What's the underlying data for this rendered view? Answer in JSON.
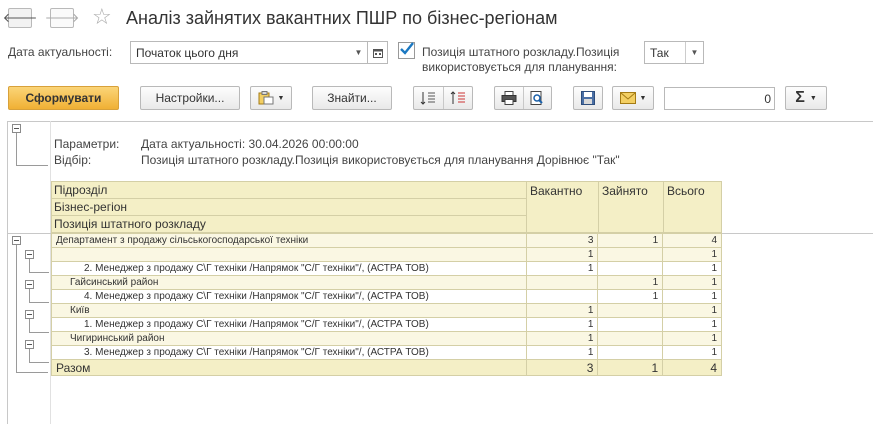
{
  "header": {
    "title": "Аналіз зайнятих вакантних ПШР по бізнес-регіонам",
    "back_glyph": "🡐",
    "forward_glyph": "🡒",
    "star_glyph": "☆"
  },
  "filters": {
    "date_label": "Дата актуальності:",
    "date_value": "Початок цього дня",
    "position_label_line1": "Позиція штатного розкладу.Позиція",
    "position_label_line2": "використовується для планування:",
    "position_checked": true,
    "position_value": "Так"
  },
  "toolbar": {
    "generate": "Сформувати",
    "settings": "Настройки...",
    "find": "Знайти...",
    "sum_value": "0",
    "sigma": "Σ"
  },
  "report": {
    "params_label": "Параметри:",
    "params_value": "Дата актуальності: 30.04.2026 00:00:00",
    "filter_label": "Відбір:",
    "filter_value": "Позиція штатного розкладу.Позиція використовується для планування Дорівнює \"Так\"",
    "col_headers": {
      "group1": "Підрозділ",
      "group2": "Бізнес-регіон",
      "group3": "Позиція штатного розкладу",
      "vacant": "Вакантно",
      "occupied": "Зайнято",
      "total": "Всього"
    },
    "rows": [
      {
        "label": "Департамент з  продажу сільськогосподарської техніки",
        "level": 0,
        "vacant": "3",
        "occupied": "1",
        "total": "4"
      },
      {
        "label": "",
        "level": 1,
        "vacant": "1",
        "occupied": "",
        "total": "1"
      },
      {
        "label": "2. Менеджер з продажу С\\Г техніки /Напрямок \"С/Г техніки\"/, (АСТРА ТОВ)",
        "level": 2,
        "vacant": "1",
        "occupied": "",
        "total": "1"
      },
      {
        "label": "Гайсинський район",
        "level": 1,
        "vacant": "",
        "occupied": "1",
        "total": "1"
      },
      {
        "label": "4. Менеджер з продажу С\\Г техніки /Напрямок \"С/Г техніки\"/, (АСТРА ТОВ)",
        "level": 2,
        "vacant": "",
        "occupied": "1",
        "total": "1"
      },
      {
        "label": "Київ",
        "level": 1,
        "vacant": "1",
        "occupied": "",
        "total": "1"
      },
      {
        "label": "1. Менеджер з продажу С\\Г техніки /Напрямок \"С/Г техніки\"/, (АСТРА ТОВ)",
        "level": 2,
        "vacant": "1",
        "occupied": "",
        "total": "1"
      },
      {
        "label": "Чигиринський район",
        "level": 1,
        "vacant": "1",
        "occupied": "",
        "total": "1"
      },
      {
        "label": "3. Менеджер з продажу С\\Г техніки /Напрямок \"С/Г техніки\"/, (АСТРА ТОВ)",
        "level": 2,
        "vacant": "1",
        "occupied": "",
        "total": "1"
      }
    ],
    "total": {
      "label": "Разом",
      "vacant": "3",
      "occupied": "1",
      "total": "4"
    }
  }
}
